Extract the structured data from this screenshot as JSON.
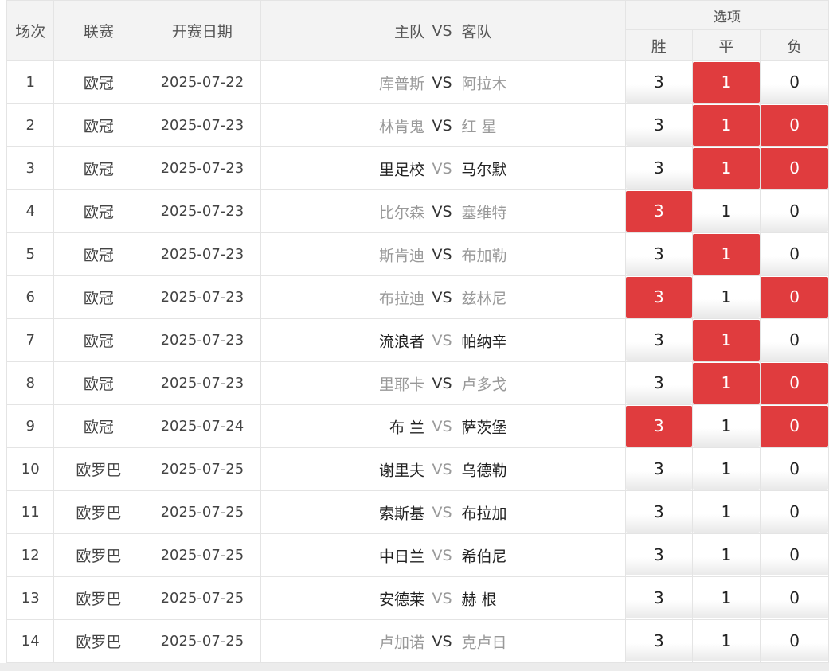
{
  "header": {
    "col_no": "场次",
    "col_league": "联赛",
    "col_date": "开赛日期",
    "col_home": "主队",
    "col_vs": "VS",
    "col_away": "客队",
    "col_options": "选项",
    "opt_win": "胜",
    "opt_draw": "平",
    "opt_loss": "负"
  },
  "colors": {
    "selected": "#e03c3e",
    "dim_text": "#999999",
    "dark_text": "#222222"
  },
  "rows": [
    {
      "no": "1",
      "league": "欧冠",
      "date": "2025-07-22",
      "home": "库普斯",
      "vs": "VS",
      "away": "阿拉木",
      "home_style": "dim",
      "away_style": "dim",
      "vs_style": "dark",
      "win": "3",
      "draw": "1",
      "loss": "0",
      "selected": [
        "draw"
      ]
    },
    {
      "no": "2",
      "league": "欧冠",
      "date": "2025-07-23",
      "home": "林肯鬼",
      "vs": "VS",
      "away": "红 星",
      "home_style": "dim",
      "away_style": "dim",
      "vs_style": "dark",
      "win": "3",
      "draw": "1",
      "loss": "0",
      "selected": [
        "draw",
        "loss"
      ]
    },
    {
      "no": "3",
      "league": "欧冠",
      "date": "2025-07-23",
      "home": "里足校",
      "vs": "VS",
      "away": "马尔默",
      "home_style": "dark",
      "away_style": "dark",
      "vs_style": "dim",
      "win": "3",
      "draw": "1",
      "loss": "0",
      "selected": [
        "draw",
        "loss"
      ]
    },
    {
      "no": "4",
      "league": "欧冠",
      "date": "2025-07-23",
      "home": "比尔森",
      "vs": "VS",
      "away": "塞维特",
      "home_style": "dim",
      "away_style": "dim",
      "vs_style": "dark",
      "win": "3",
      "draw": "1",
      "loss": "0",
      "selected": [
        "win"
      ]
    },
    {
      "no": "5",
      "league": "欧冠",
      "date": "2025-07-23",
      "home": "斯肯迪",
      "vs": "VS",
      "away": "布加勒",
      "home_style": "dim",
      "away_style": "dim",
      "vs_style": "dark",
      "win": "3",
      "draw": "1",
      "loss": "0",
      "selected": [
        "draw"
      ]
    },
    {
      "no": "6",
      "league": "欧冠",
      "date": "2025-07-23",
      "home": "布拉迪",
      "vs": "VS",
      "away": "兹林尼",
      "home_style": "dim",
      "away_style": "dim",
      "vs_style": "dark",
      "win": "3",
      "draw": "1",
      "loss": "0",
      "selected": [
        "win",
        "loss"
      ]
    },
    {
      "no": "7",
      "league": "欧冠",
      "date": "2025-07-23",
      "home": "流浪者",
      "vs": "VS",
      "away": "帕纳辛",
      "home_style": "dark",
      "away_style": "dark",
      "vs_style": "dim",
      "win": "3",
      "draw": "1",
      "loss": "0",
      "selected": [
        "draw"
      ]
    },
    {
      "no": "8",
      "league": "欧冠",
      "date": "2025-07-23",
      "home": "里耶卡",
      "vs": "VS",
      "away": "卢多戈",
      "home_style": "dim",
      "away_style": "dim",
      "vs_style": "dark",
      "win": "3",
      "draw": "1",
      "loss": "0",
      "selected": [
        "draw",
        "loss"
      ]
    },
    {
      "no": "9",
      "league": "欧冠",
      "date": "2025-07-24",
      "home": "布 兰",
      "vs": "VS",
      "away": "萨茨堡",
      "home_style": "dark",
      "away_style": "dark",
      "vs_style": "dim",
      "win": "3",
      "draw": "1",
      "loss": "0",
      "selected": [
        "win",
        "loss"
      ]
    },
    {
      "no": "10",
      "league": "欧罗巴",
      "date": "2025-07-25",
      "home": "谢里夫",
      "vs": "VS",
      "away": "乌德勒",
      "home_style": "dark",
      "away_style": "dark",
      "vs_style": "dim",
      "win": "3",
      "draw": "1",
      "loss": "0",
      "selected": []
    },
    {
      "no": "11",
      "league": "欧罗巴",
      "date": "2025-07-25",
      "home": "索斯基",
      "vs": "VS",
      "away": "布拉加",
      "home_style": "dark",
      "away_style": "dark",
      "vs_style": "dim",
      "win": "3",
      "draw": "1",
      "loss": "0",
      "selected": []
    },
    {
      "no": "12",
      "league": "欧罗巴",
      "date": "2025-07-25",
      "home": "中日兰",
      "vs": "VS",
      "away": "希伯尼",
      "home_style": "dark",
      "away_style": "dark",
      "vs_style": "dim",
      "win": "3",
      "draw": "1",
      "loss": "0",
      "selected": []
    },
    {
      "no": "13",
      "league": "欧罗巴",
      "date": "2025-07-25",
      "home": "安德莱",
      "vs": "VS",
      "away": "赫 根",
      "home_style": "dark",
      "away_style": "dark",
      "vs_style": "dim",
      "win": "3",
      "draw": "1",
      "loss": "0",
      "selected": []
    },
    {
      "no": "14",
      "league": "欧罗巴",
      "date": "2025-07-25",
      "home": "卢加诺",
      "vs": "VS",
      "away": "克卢日",
      "home_style": "dim",
      "away_style": "dim",
      "vs_style": "dark",
      "win": "3",
      "draw": "1",
      "loss": "0",
      "selected": []
    }
  ]
}
